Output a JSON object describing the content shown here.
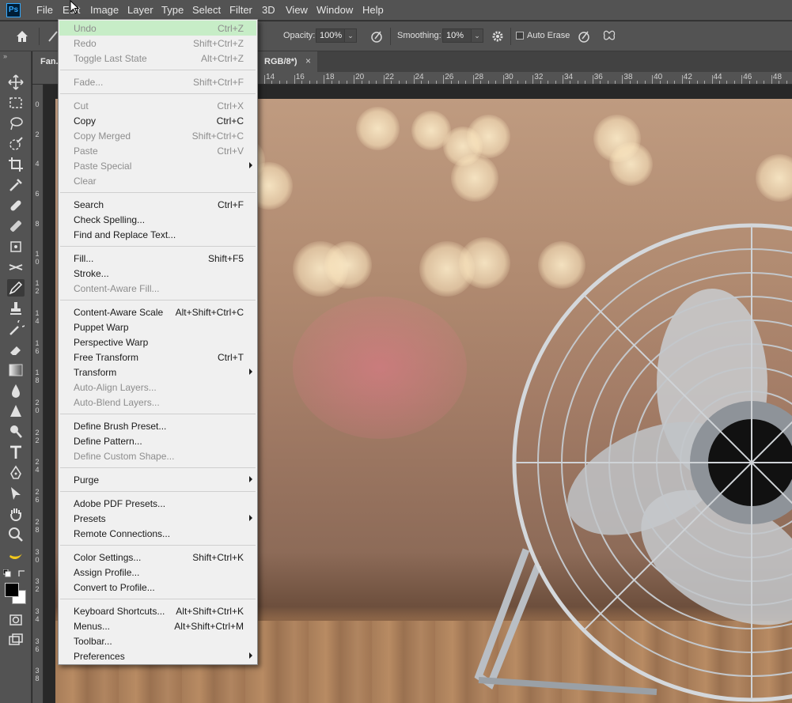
{
  "app": {
    "logo": "Ps"
  },
  "menubar": {
    "items": [
      "File",
      "Edit",
      "Image",
      "Layer",
      "Type",
      "Select",
      "Filter",
      "3D",
      "View",
      "Window",
      "Help"
    ]
  },
  "options": {
    "opacity_label": "Opacity:",
    "opacity_value": "100%",
    "smoothing_label": "Smoothing:",
    "smoothing_value": "10%",
    "auto_erase_label": "Auto Erase"
  },
  "document_tab": {
    "title": "Fan.",
    "mode": "RGB/8*)",
    "close": "×"
  },
  "ruler_top": [
    "14",
    "16",
    "18",
    "20",
    "22",
    "24",
    "26",
    "28",
    "30",
    "32",
    "34",
    "36",
    "38",
    "40",
    "42",
    "44",
    "46",
    "48"
  ],
  "ruler_left": [
    "0",
    "2",
    "4",
    "6",
    "8",
    "10",
    "12",
    "14",
    "16",
    "18",
    "20",
    "22",
    "24",
    "26",
    "28",
    "30",
    "32",
    "34",
    "36",
    "38"
  ],
  "edit_menu": {
    "groups": [
      [
        {
          "label": "Undo",
          "shortcut": "Ctrl+Z",
          "disabled": true,
          "highlighted": true
        },
        {
          "label": "Redo",
          "shortcut": "Shift+Ctrl+Z",
          "disabled": true
        },
        {
          "label": "Toggle Last State",
          "shortcut": "Alt+Ctrl+Z",
          "disabled": true
        }
      ],
      [
        {
          "label": "Fade...",
          "shortcut": "Shift+Ctrl+F",
          "disabled": true
        }
      ],
      [
        {
          "label": "Cut",
          "shortcut": "Ctrl+X",
          "disabled": true
        },
        {
          "label": "Copy",
          "shortcut": "Ctrl+C"
        },
        {
          "label": "Copy Merged",
          "shortcut": "Shift+Ctrl+C",
          "disabled": true
        },
        {
          "label": "Paste",
          "shortcut": "Ctrl+V",
          "disabled": true
        },
        {
          "label": "Paste Special",
          "submenu": true,
          "disabled": true
        },
        {
          "label": "Clear",
          "disabled": true
        }
      ],
      [
        {
          "label": "Search",
          "shortcut": "Ctrl+F"
        },
        {
          "label": "Check Spelling..."
        },
        {
          "label": "Find and Replace Text..."
        }
      ],
      [
        {
          "label": "Fill...",
          "shortcut": "Shift+F5"
        },
        {
          "label": "Stroke..."
        },
        {
          "label": "Content-Aware Fill...",
          "disabled": true
        }
      ],
      [
        {
          "label": "Content-Aware Scale",
          "shortcut": "Alt+Shift+Ctrl+C"
        },
        {
          "label": "Puppet Warp"
        },
        {
          "label": "Perspective Warp"
        },
        {
          "label": "Free Transform",
          "shortcut": "Ctrl+T"
        },
        {
          "label": "Transform",
          "submenu": true
        },
        {
          "label": "Auto-Align Layers...",
          "disabled": true
        },
        {
          "label": "Auto-Blend Layers...",
          "disabled": true
        }
      ],
      [
        {
          "label": "Define Brush Preset..."
        },
        {
          "label": "Define Pattern..."
        },
        {
          "label": "Define Custom Shape...",
          "disabled": true
        }
      ],
      [
        {
          "label": "Purge",
          "submenu": true
        }
      ],
      [
        {
          "label": "Adobe PDF Presets..."
        },
        {
          "label": "Presets",
          "submenu": true
        },
        {
          "label": "Remote Connections..."
        }
      ],
      [
        {
          "label": "Color Settings...",
          "shortcut": "Shift+Ctrl+K"
        },
        {
          "label": "Assign Profile..."
        },
        {
          "label": "Convert to Profile..."
        }
      ],
      [
        {
          "label": "Keyboard Shortcuts...",
          "shortcut": "Alt+Shift+Ctrl+K"
        },
        {
          "label": "Menus...",
          "shortcut": "Alt+Shift+Ctrl+M"
        },
        {
          "label": "Toolbar..."
        },
        {
          "label": "Preferences",
          "submenu": true
        }
      ]
    ]
  },
  "colors": {
    "chrome": "#535353",
    "menu_bg": "#f0f0f0",
    "menu_highlight": "#c7edc7",
    "ps_blue": "#31a8ff"
  }
}
